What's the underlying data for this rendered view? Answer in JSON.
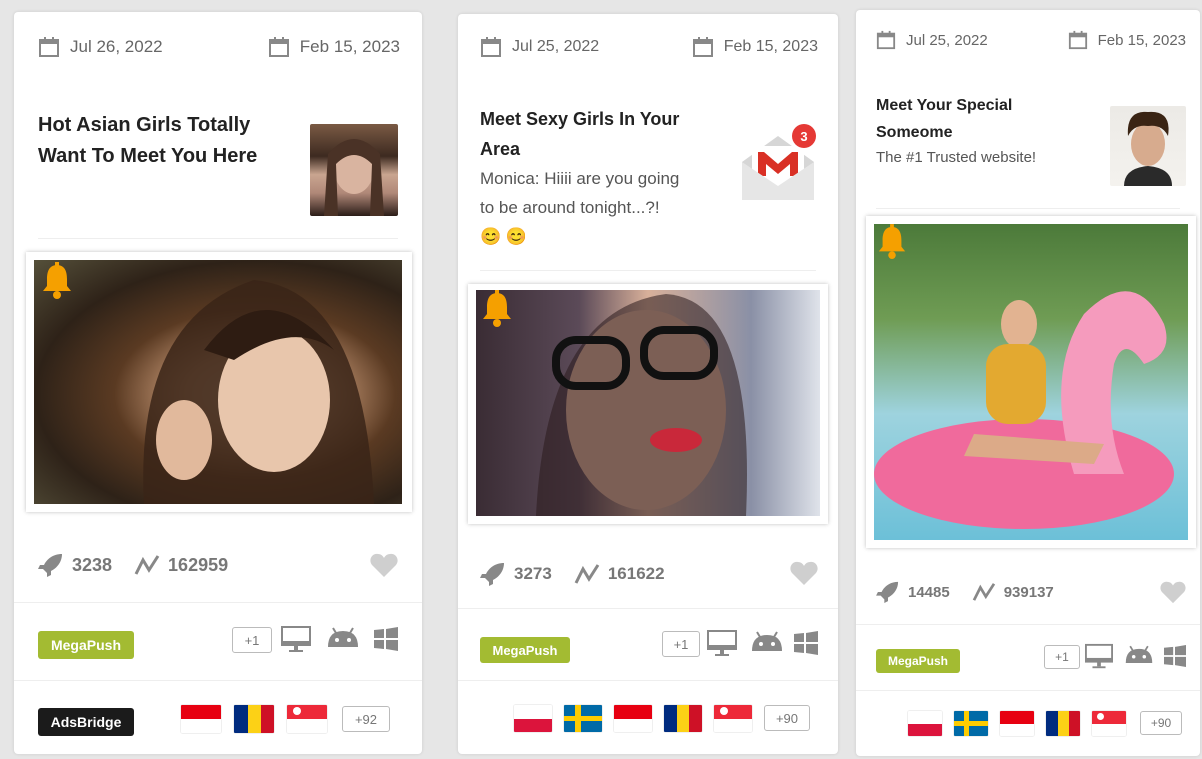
{
  "cards": [
    {
      "start_date": "Jul 26, 2022",
      "end_date": "Feb 15, 2023",
      "title": "Hot Asian Girls Totally Want To Meet You Here",
      "subtitle": "",
      "launches": "3238",
      "reach": "162959",
      "network": "MegaPush",
      "os_more": "+1",
      "tracker": "AdsBridge",
      "flags": [
        "Indonesia",
        "Romania",
        "Singapore"
      ],
      "flags_more": "+92"
    },
    {
      "start_date": "Jul 25, 2022",
      "end_date": "Feb 15, 2023",
      "title": "Meet Sexy Girls In Your Area",
      "subtitle": "Monica: Hiiii are you going to be around tonight...?! 😊 😊",
      "notification_count": "3",
      "launches": "3273",
      "reach": "161622",
      "network": "MegaPush",
      "os_more": "+1",
      "flags": [
        "Poland",
        "Sweden",
        "Indonesia",
        "Romania",
        "Singapore"
      ],
      "flags_more": "+90"
    },
    {
      "start_date": "Jul 25, 2022",
      "end_date": "Feb 15, 2023",
      "title": "Meet Your Special Someome",
      "subtitle": "The #1 Trusted website!",
      "launches": "14485",
      "reach": "939137",
      "network": "MegaPush",
      "os_more": "+1",
      "flags": [
        "Poland",
        "Sweden",
        "Indonesia",
        "Romania",
        "Singapore"
      ],
      "flags_more": "+90"
    }
  ],
  "colors": {
    "network_badge": "#a3bb32",
    "tracker_badge": "#1b1b1b",
    "bell": "#f5a000",
    "icon_grey": "#888888"
  }
}
